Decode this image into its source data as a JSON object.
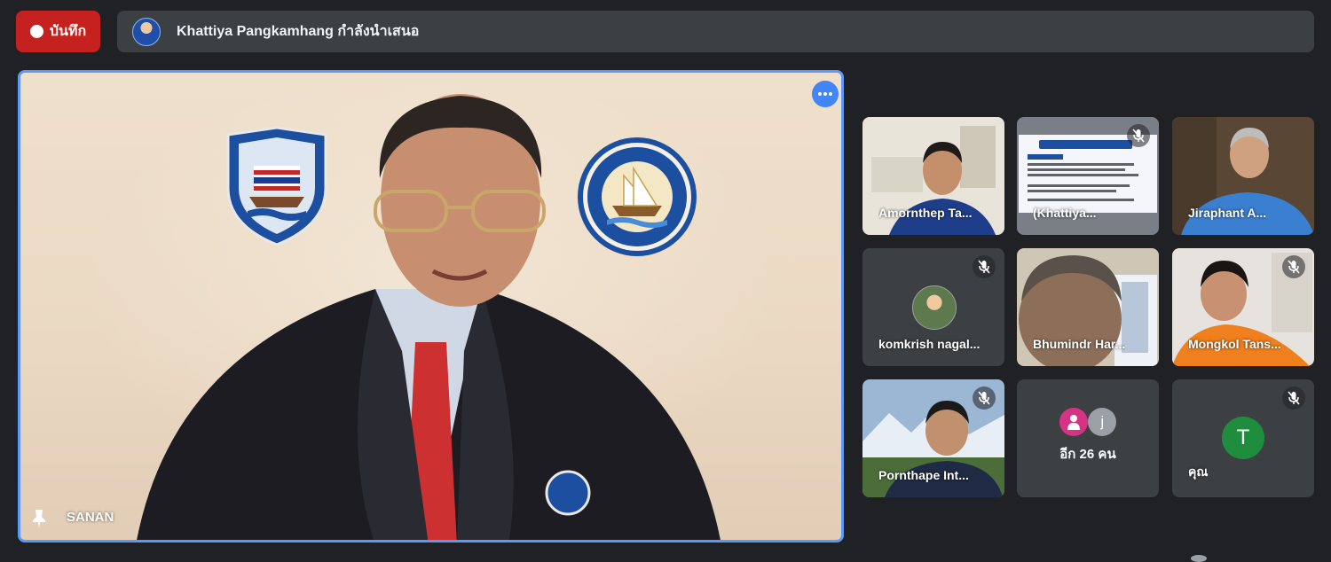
{
  "record": {
    "label": "บันทึก"
  },
  "presenter": {
    "text": "Khattiya Pangkamhang กำลังนำเสนอ"
  },
  "main": {
    "name": "SANAN"
  },
  "tiles": [
    {
      "name": "Amornthep Ta...",
      "muted": false
    },
    {
      "name": "(Khattiya...",
      "muted": true
    },
    {
      "name": "Jiraphant A...",
      "muted": false
    },
    {
      "name": "komkrish nagal...",
      "muted": true
    },
    {
      "name": "Bhumindr Har...",
      "muted": false
    },
    {
      "name": "Mongkol Tans...",
      "muted": true
    },
    {
      "name": "Pornthape Int...",
      "muted": true
    },
    {
      "name": "อีก 26 คน",
      "avatar_letter": "j"
    },
    {
      "name": "คุณ",
      "avatar_letter": "T",
      "muted": true
    }
  ],
  "colors": {
    "background": "#202124",
    "record": "#c5221f",
    "presenter_bar": "#3c4043",
    "active_border": "#5e97f6",
    "avatar_t": "#1e8e3e",
    "avatar_j": "#9aa0a6",
    "avatar_pink": "#d63384"
  },
  "icons": [
    "record-dot-icon",
    "more-options-icon",
    "pin-icon",
    "mic-off-icon"
  ]
}
